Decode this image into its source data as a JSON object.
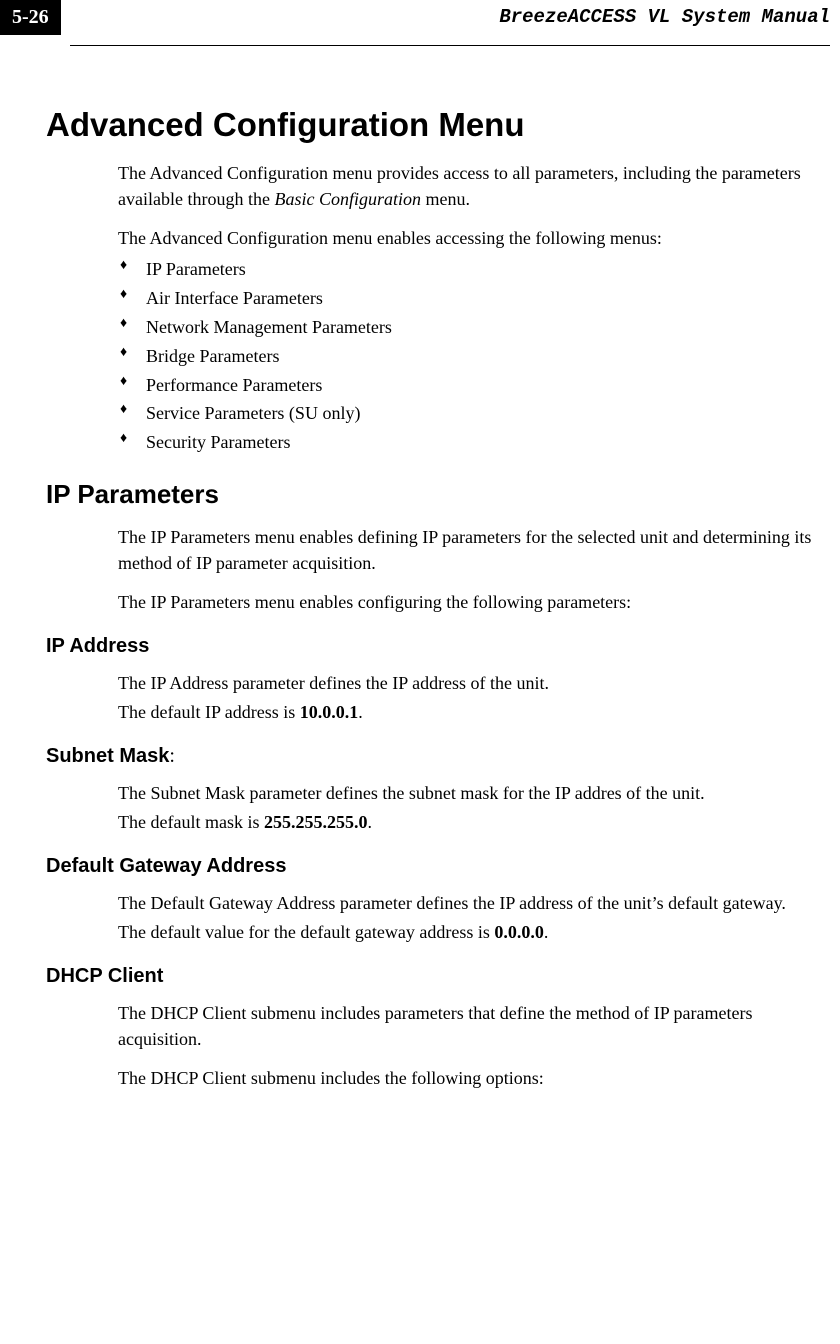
{
  "header": {
    "page_number": "5-26",
    "manual_title": "BreezeACCESS VL System Manual"
  },
  "h1": "Advanced Configuration Menu",
  "intro_p1a": "The Advanced Configuration menu provides access to all parameters, including the parameters available through the ",
  "intro_p1_italic": "Basic Configuration",
  "intro_p1b": " menu.",
  "intro_p2": "The Advanced Configuration menu enables accessing the following menus:",
  "menu_items": [
    "IP Parameters",
    "Air Interface Parameters",
    "Network Management Parameters",
    "Bridge Parameters",
    "Performance Parameters",
    "Service Parameters (SU only)",
    "Security Parameters"
  ],
  "ip_params": {
    "heading": "IP Parameters",
    "p1": "The IP Parameters menu enables defining IP parameters for the selected unit and determining its method of IP parameter acquisition.",
    "p2": "The IP Parameters menu enables configuring the following parameters:"
  },
  "ip_address": {
    "heading": "IP Address",
    "line1": "The IP Address parameter defines the IP address of the unit.",
    "line2a": "The default IP address is ",
    "line2_bold": "10.0.0.1",
    "line2b": "."
  },
  "subnet_mask": {
    "heading_bold": "Subnet Mask",
    "heading_plain": ":",
    "line1": "The Subnet Mask parameter defines the subnet mask for the IP addres of the unit.",
    "line2a": "The default mask is ",
    "line2_bold": "255.255.255.0",
    "line2b": "."
  },
  "gateway": {
    "heading": "Default Gateway Address",
    "line1": "The Default Gateway Address parameter defines the IP address of the unit’s default gateway.",
    "line2a": "The default value for the default gateway address is ",
    "line2_bold": "0.0.0.0",
    "line2b": "."
  },
  "dhcp": {
    "heading": "DHCP Client",
    "p1": "The DHCP Client submenu includes parameters that define the method of IP parameters acquisition.",
    "p2": "The DHCP Client submenu includes the following options:"
  }
}
